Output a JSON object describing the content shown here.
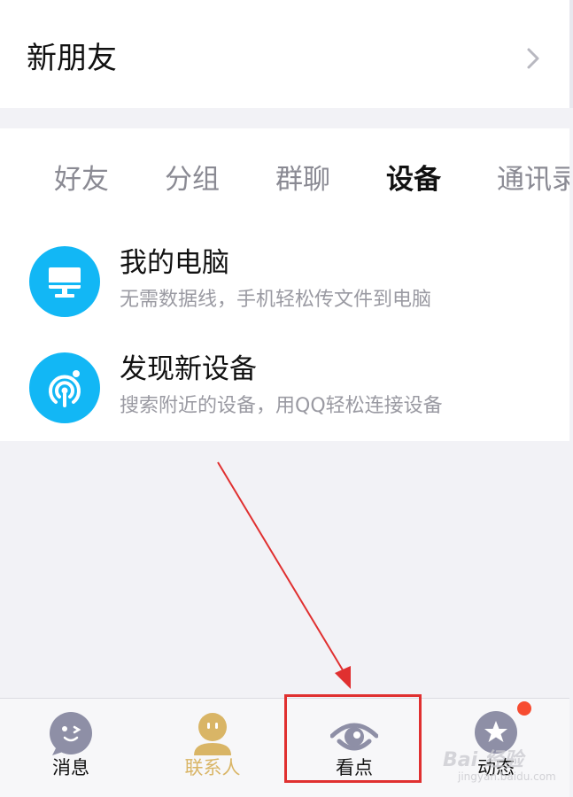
{
  "new_friends": {
    "label": "新朋友"
  },
  "contact_tabs": [
    "好友",
    "分组",
    "群聊",
    "设备",
    "通讯录"
  ],
  "active_tab": "设备",
  "devices": [
    {
      "title": "我的电脑",
      "subtitle": "无需数据线，手机轻松传文件到电脑",
      "icon": "monitor-icon"
    },
    {
      "title": "发现新设备",
      "subtitle": "搜索附近的设备，用QQ轻松连接设备",
      "icon": "signal-icon"
    }
  ],
  "bottom_nav": [
    {
      "label": "消息",
      "icon": "messages-face-icon"
    },
    {
      "label": "联系人",
      "icon": "contacts-person-icon"
    },
    {
      "label": "看点",
      "icon": "eye-icon"
    },
    {
      "label": "动态",
      "icon": "star-icon"
    }
  ],
  "active_nav": "联系人",
  "watermark": {
    "text": "Bai 经验",
    "sub": "jingyan.baidu.com"
  },
  "colors": {
    "accent_blue": "#12b7f5",
    "active_nav": "#d9b566",
    "badge": "#f74c31",
    "annotation_red": "#e03030",
    "inactive_icon": "#8e8fa6"
  }
}
